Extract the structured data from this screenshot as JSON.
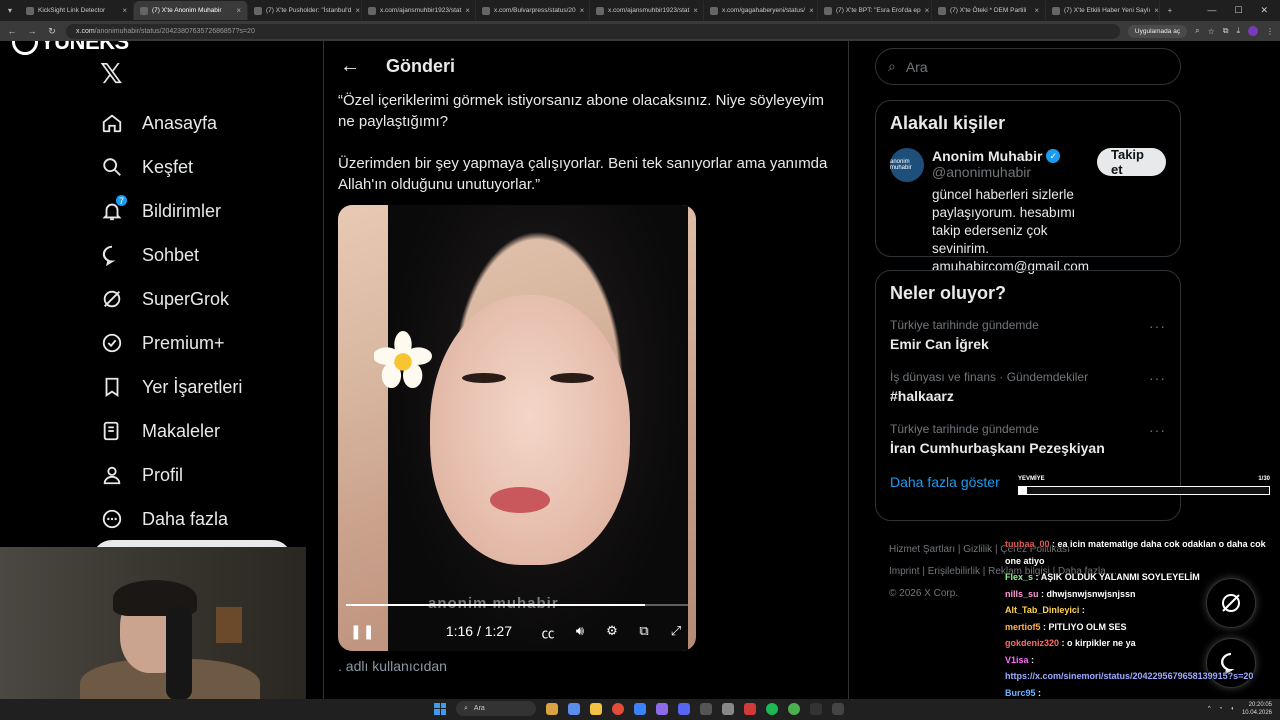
{
  "browser": {
    "tabs": [
      {
        "label": "KickSight Link Detector",
        "active": false
      },
      {
        "label": "(7) X'te Anonim Muhabir",
        "active": true
      },
      {
        "label": "(7) X'te Pusholder: \"İstanbul'd",
        "active": false
      },
      {
        "label": "x.com/ajansmuhbir1923/stat",
        "active": false
      },
      {
        "label": "x.com/Bulvarpress/status/20",
        "active": false
      },
      {
        "label": "x.com/ajansmuhbir1923/stat",
        "active": false
      },
      {
        "label": "x.com/gagahaberyeni/status/",
        "active": false
      },
      {
        "label": "(7) X'te BPT: \"Esra Erol'da ep",
        "active": false
      },
      {
        "label": "(7) X'te Öteki * DEM Partili",
        "active": false
      },
      {
        "label": "(7) X'te Etkili Haber Yeni Saylı",
        "active": false
      }
    ],
    "url_host": "x.com",
    "url_path": "/anonimuhabir/status/2042380763572686857?s=20",
    "open_in_app": "Uygulamada aç"
  },
  "brand": {
    "logo_text": "YUNEKS"
  },
  "nav": {
    "items": [
      {
        "label": "Anasayfa",
        "icon": "home-icon"
      },
      {
        "label": "Keşfet",
        "icon": "search-icon"
      },
      {
        "label": "Bildirimler",
        "icon": "bell-icon",
        "badge": "7"
      },
      {
        "label": "Sohbet",
        "icon": "chat-icon"
      },
      {
        "label": "SuperGrok",
        "icon": "grok-icon"
      },
      {
        "label": "Premium+",
        "icon": "verified-icon"
      },
      {
        "label": "Yer İşaretleri",
        "icon": "bookmark-icon"
      },
      {
        "label": "Makaleler",
        "icon": "article-icon"
      },
      {
        "label": "Profil",
        "icon": "profile-icon"
      },
      {
        "label": "Daha fazla",
        "icon": "more-icon"
      }
    ]
  },
  "post": {
    "header_title": "Gönderi",
    "paragraph1": "“Özel içeriklerimi görmek istiyorsanız abone olacaksınız. Niye söyleyeyim ne paylaştığımı?",
    "paragraph2": "Üzerimden bir şey yapmaya çalışıyorlar. Beni tek sanıyorlar ama yanımda Allah'ın olduğunu unutuyorlar.”",
    "video": {
      "time": "1:16 / 1:27",
      "progress": 0.874,
      "watermark": "anonim muhabir",
      "state": "playing"
    },
    "below_text": ". adlı kullanıcıdan"
  },
  "sidebar": {
    "search_placeholder": "Ara",
    "related_title": "Alakalı kişiler",
    "related": {
      "name": "Anonim Muhabir",
      "handle": "@anonimuhabir",
      "avatar_text": "anonim muhabir",
      "bio": "güncel haberleri sizlerle paylaşıyorum. hesabımı takip ederseniz çok sevinirim. amuhabircom@gmail.com",
      "follow_label": "Takip et"
    },
    "trends_title": "Neler oluyor?",
    "trends": [
      {
        "meta": "Türkiye tarihinde gündemde",
        "name": "Emir Can İğrek"
      },
      {
        "meta": "İş dünyası ve finans · Gündemdekiler",
        "name": "#halkaarz"
      },
      {
        "meta": "Türkiye tarihinde gündemde",
        "name": "İran Cumhurbaşkanı Pezeşkiyan"
      }
    ],
    "show_more": "Daha fazla göster",
    "footer_line1": [
      "Hizmet Şartları",
      "Gizlilik",
      "Çerez Politikası"
    ],
    "footer_line2": [
      "Imprint",
      "Erişilebilirlik",
      "Reklam bilgisi",
      "Daha fazla ..."
    ],
    "copyright": "© 2026 X Corp."
  },
  "stream_overlay": {
    "goal_label": "YEVMİYE",
    "goal_count": "1/30",
    "goal_progress": 0.0333,
    "chat": [
      {
        "user": "tuubaa_00",
        "text": ": ea icin matematige daha cok odaklan o daha cok one atiyo",
        "color": "#e05858"
      },
      {
        "user": "Flex_s",
        "text": ": AŞIK OLDUK YALANMI SOYLEYELİM",
        "color": "#8ef58e"
      },
      {
        "user": "nills_su",
        "text": ": dhwjsnwjsnwjsnjssn",
        "color": "#ff9ad9"
      },
      {
        "user": "Alt_Tab_Dinleyici",
        "text": ":",
        "color": "#ffd34d"
      },
      {
        "user": "mertiof5",
        "text": ": PITLIYO OLM SES",
        "color": "#ffb24d"
      },
      {
        "user": "gokdeniz320",
        "text": ": o kirpikler ne ya",
        "color": "#ff6b6b"
      },
      {
        "user": "V1isa",
        "text": ":",
        "color": "#ff6bff"
      },
      {
        "user": "",
        "text": "https://x.com/sinemori/status/2042295679658139915?s=20",
        "color": "#9ea8ff"
      },
      {
        "user": "Burc95",
        "text": ":",
        "color": "#6bb5ff"
      }
    ]
  },
  "taskbar": {
    "search": "Ara",
    "time": "20:20:05",
    "date": "10.04.2026"
  }
}
